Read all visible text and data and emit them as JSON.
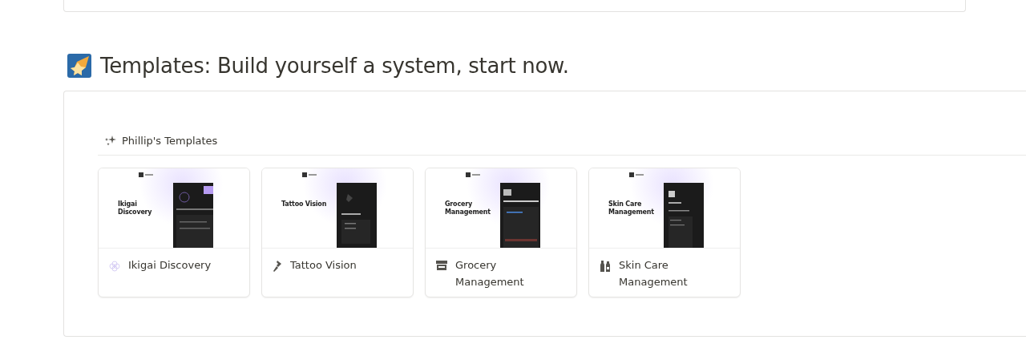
{
  "heading": "Templates: Build yourself a system, start now.",
  "gallery": {
    "title": "Phillip's Templates",
    "cards": [
      {
        "kind": "ikigai",
        "title": "Ikigai Discovery",
        "preview_title": "Ikigai Discovery"
      },
      {
        "kind": "tattoo",
        "title": "Tattoo Vision",
        "preview_title": "Tattoo Vision"
      },
      {
        "kind": "grocery",
        "title": "Grocery Management",
        "preview_title": "Grocery Management"
      },
      {
        "kind": "skincare",
        "title": "Skin Care Management",
        "preview_title": "Skin Care Management"
      }
    ]
  }
}
